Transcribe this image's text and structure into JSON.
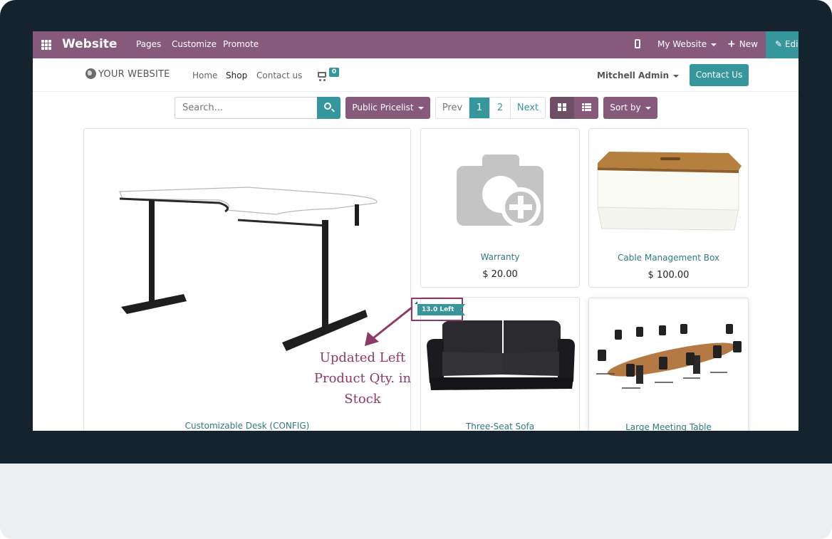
{
  "admin_bar": {
    "app_name": "Website",
    "menu": [
      "Pages",
      "Customize",
      "Promote"
    ],
    "website_selector": "My Website",
    "new_label": "New",
    "edit_label": "Edi"
  },
  "site_header": {
    "logo_text": "YOUR WEBSITE",
    "nav": [
      "Home",
      "Shop",
      "Contact us"
    ],
    "active_nav": "Shop",
    "cart_count": "0",
    "user_name": "Mitchell Admin",
    "contact_button": "Contact Us"
  },
  "toolbar": {
    "search_placeholder": "Search...",
    "pricelist_label": "Public Pricelist",
    "pager": {
      "prev": "Prev",
      "pages": [
        "1",
        "2"
      ],
      "current_page": "1",
      "next": "Next"
    },
    "sort_label": "Sort by"
  },
  "products": [
    {
      "name": "Customizable Desk (CONFIG)",
      "price": ""
    },
    {
      "name": "Warranty",
      "price": "$ 20.00"
    },
    {
      "name": "Cable Management Box",
      "price": "$ 100.00"
    },
    {
      "name": "Three-Seat Sofa",
      "price": "",
      "stock_badge": "13.0 Left"
    },
    {
      "name": "Large Meeting Table",
      "price": ""
    }
  ],
  "annotation": {
    "text": [
      "Updated Left",
      "Product Qty. in",
      "Stock"
    ]
  },
  "colors": {
    "admin_bar": "#875a7b",
    "primary_teal": "#35979c",
    "product_link": "#2f7a80",
    "annotation": "#8d3a66",
    "frame": "#15232f"
  }
}
